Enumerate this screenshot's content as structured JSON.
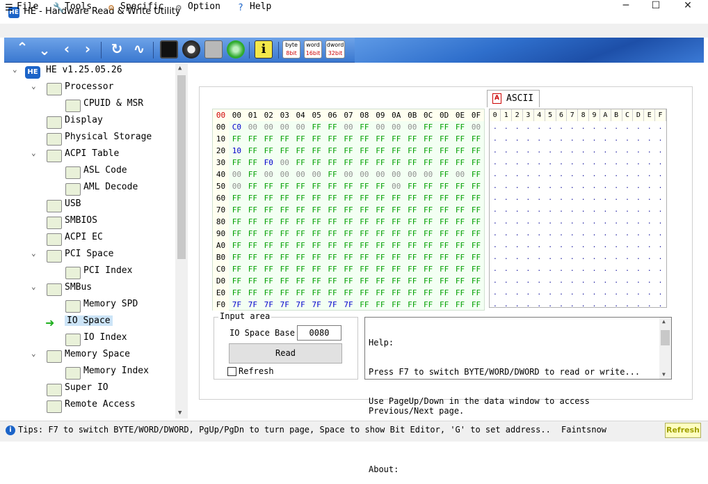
{
  "window": {
    "title": "HE - Hardware Read & Write Utility",
    "app_icon": "HE",
    "minimize_icon": "minimize-icon",
    "maximize_icon": "maximize-icon",
    "close_icon": "close-icon"
  },
  "menu": [
    {
      "label": "File",
      "icon": "list-icon"
    },
    {
      "label": "Tools",
      "icon": "wrench-icon"
    },
    {
      "label": "Specific",
      "icon": "gears-icon"
    },
    {
      "label": "Option",
      "icon": "gear-icon"
    },
    {
      "label": "Help",
      "icon": "question-icon"
    }
  ],
  "toolbar": {
    "nav": [
      {
        "name": "up",
        "glyph": "⌃"
      },
      {
        "name": "down",
        "glyph": "⌄"
      },
      {
        "name": "back",
        "glyph": "‹"
      },
      {
        "name": "forward",
        "glyph": "›"
      },
      {
        "name": "refresh",
        "glyph": "↻"
      },
      {
        "name": "chart",
        "glyph": "∿"
      }
    ],
    "width_buttons": [
      {
        "top": "byte",
        "bottom": "8bit"
      },
      {
        "top": "word",
        "bottom": "16bit"
      },
      {
        "top": "dword",
        "bottom": "32bit"
      }
    ]
  },
  "tree": {
    "root": "HE v1.25.05.26",
    "items": [
      {
        "label": "Processor",
        "level": 1
      },
      {
        "label": "CPUID & MSR",
        "level": 2
      },
      {
        "label": "Display",
        "level": 1
      },
      {
        "label": "Physical Storage",
        "level": 1
      },
      {
        "label": "ACPI Table",
        "level": 1
      },
      {
        "label": "ASL Code",
        "level": 2
      },
      {
        "label": "AML Decode",
        "level": 2
      },
      {
        "label": "USB",
        "level": 1
      },
      {
        "label": "SMBIOS",
        "level": 1
      },
      {
        "label": "ACPI EC",
        "level": 1
      },
      {
        "label": "PCI Space",
        "level": 1
      },
      {
        "label": "PCI Index",
        "level": 2
      },
      {
        "label": "SMBus",
        "level": 1
      },
      {
        "label": "Memory SPD",
        "level": 2
      },
      {
        "label": "IO Space",
        "level": 1,
        "selected": true
      },
      {
        "label": "IO Index",
        "level": 2
      },
      {
        "label": "Memory Space",
        "level": 1
      },
      {
        "label": "Memory Index",
        "level": 2
      },
      {
        "label": "Super IO",
        "level": 1
      },
      {
        "label": "Remote Access",
        "level": 1
      }
    ]
  },
  "hex": {
    "corner": "00",
    "columns": [
      "00",
      "01",
      "02",
      "03",
      "04",
      "05",
      "06",
      "07",
      "08",
      "09",
      "0A",
      "0B",
      "0C",
      "0D",
      "0E",
      "0F"
    ],
    "rows": [
      {
        "addr": "00",
        "cells": [
          "C0",
          "00",
          "00",
          "00",
          "00",
          "FF",
          "FF",
          "00",
          "FF",
          "00",
          "00",
          "00",
          "FF",
          "FF",
          "FF",
          "00"
        ]
      },
      {
        "addr": "10",
        "cells": [
          "FF",
          "FF",
          "FF",
          "FF",
          "FF",
          "FF",
          "FF",
          "FF",
          "FF",
          "FF",
          "FF",
          "FF",
          "FF",
          "FF",
          "FF",
          "FF"
        ]
      },
      {
        "addr": "20",
        "cells": [
          "10",
          "FF",
          "FF",
          "FF",
          "FF",
          "FF",
          "FF",
          "FF",
          "FF",
          "FF",
          "FF",
          "FF",
          "FF",
          "FF",
          "FF",
          "FF"
        ]
      },
      {
        "addr": "30",
        "cells": [
          "FF",
          "FF",
          "F0",
          "00",
          "FF",
          "FF",
          "FF",
          "FF",
          "FF",
          "FF",
          "FF",
          "FF",
          "FF",
          "FF",
          "FF",
          "FF"
        ]
      },
      {
        "addr": "40",
        "cells": [
          "00",
          "FF",
          "00",
          "00",
          "00",
          "00",
          "FF",
          "00",
          "00",
          "00",
          "00",
          "00",
          "00",
          "FF",
          "00",
          "FF"
        ]
      },
      {
        "addr": "50",
        "cells": [
          "00",
          "FF",
          "FF",
          "FF",
          "FF",
          "FF",
          "FF",
          "FF",
          "FF",
          "FF",
          "00",
          "FF",
          "FF",
          "FF",
          "FF",
          "FF"
        ]
      },
      {
        "addr": "60",
        "cells": [
          "FF",
          "FF",
          "FF",
          "FF",
          "FF",
          "FF",
          "FF",
          "FF",
          "FF",
          "FF",
          "FF",
          "FF",
          "FF",
          "FF",
          "FF",
          "FF"
        ]
      },
      {
        "addr": "70",
        "cells": [
          "FF",
          "FF",
          "FF",
          "FF",
          "FF",
          "FF",
          "FF",
          "FF",
          "FF",
          "FF",
          "FF",
          "FF",
          "FF",
          "FF",
          "FF",
          "FF"
        ]
      },
      {
        "addr": "80",
        "cells": [
          "FF",
          "FF",
          "FF",
          "FF",
          "FF",
          "FF",
          "FF",
          "FF",
          "FF",
          "FF",
          "FF",
          "FF",
          "FF",
          "FF",
          "FF",
          "FF"
        ]
      },
      {
        "addr": "90",
        "cells": [
          "FF",
          "FF",
          "FF",
          "FF",
          "FF",
          "FF",
          "FF",
          "FF",
          "FF",
          "FF",
          "FF",
          "FF",
          "FF",
          "FF",
          "FF",
          "FF"
        ]
      },
      {
        "addr": "A0",
        "cells": [
          "FF",
          "FF",
          "FF",
          "FF",
          "FF",
          "FF",
          "FF",
          "FF",
          "FF",
          "FF",
          "FF",
          "FF",
          "FF",
          "FF",
          "FF",
          "FF"
        ]
      },
      {
        "addr": "B0",
        "cells": [
          "FF",
          "FF",
          "FF",
          "FF",
          "FF",
          "FF",
          "FF",
          "FF",
          "FF",
          "FF",
          "FF",
          "FF",
          "FF",
          "FF",
          "FF",
          "FF"
        ]
      },
      {
        "addr": "C0",
        "cells": [
          "FF",
          "FF",
          "FF",
          "FF",
          "FF",
          "FF",
          "FF",
          "FF",
          "FF",
          "FF",
          "FF",
          "FF",
          "FF",
          "FF",
          "FF",
          "FF"
        ]
      },
      {
        "addr": "D0",
        "cells": [
          "FF",
          "FF",
          "FF",
          "FF",
          "FF",
          "FF",
          "FF",
          "FF",
          "FF",
          "FF",
          "FF",
          "FF",
          "FF",
          "FF",
          "FF",
          "FF"
        ]
      },
      {
        "addr": "E0",
        "cells": [
          "FF",
          "FF",
          "FF",
          "FF",
          "FF",
          "FF",
          "FF",
          "FF",
          "FF",
          "FF",
          "FF",
          "FF",
          "FF",
          "FF",
          "FF",
          "FF"
        ]
      },
      {
        "addr": "F0",
        "cells": [
          "7F",
          "7F",
          "7F",
          "7F",
          "7F",
          "7F",
          "7F",
          "7F",
          "FF",
          "FF",
          "FF",
          "FF",
          "FF",
          "FF",
          "FF",
          "FF"
        ]
      }
    ]
  },
  "ascii": {
    "tab_label": "ASCII",
    "tab_icon": "A",
    "columns": [
      "0",
      "1",
      "2",
      "3",
      "4",
      "5",
      "6",
      "7",
      "8",
      "9",
      "A",
      "B",
      "C",
      "D",
      "E",
      "F"
    ],
    "fill_char": "."
  },
  "input_area": {
    "legend": "Input area",
    "base_label": "IO Space Base",
    "base_value": "0080",
    "read_label": "Read",
    "refresh_label": "Refresh",
    "refresh_checked": false
  },
  "help": {
    "lines": [
      "Help:",
      "Press F7 to switch BYTE/WORD/DWORD to read or write...",
      "Use PageUp/Down in the data window to access Previous/Next page.",
      "",
      "About:"
    ]
  },
  "status": {
    "tips": "Tips: F7 to switch BYTE/WORD/DWORD, PgUp/PgDn to turn page, Space to show Bit Editor, 'G' to set address..",
    "author": "Faintsnow",
    "refresh": "Refresh"
  },
  "colors": {
    "ff": "#00a000",
    "zero": "#909090",
    "other": "#0000cc",
    "accent": "#1c64c8"
  }
}
